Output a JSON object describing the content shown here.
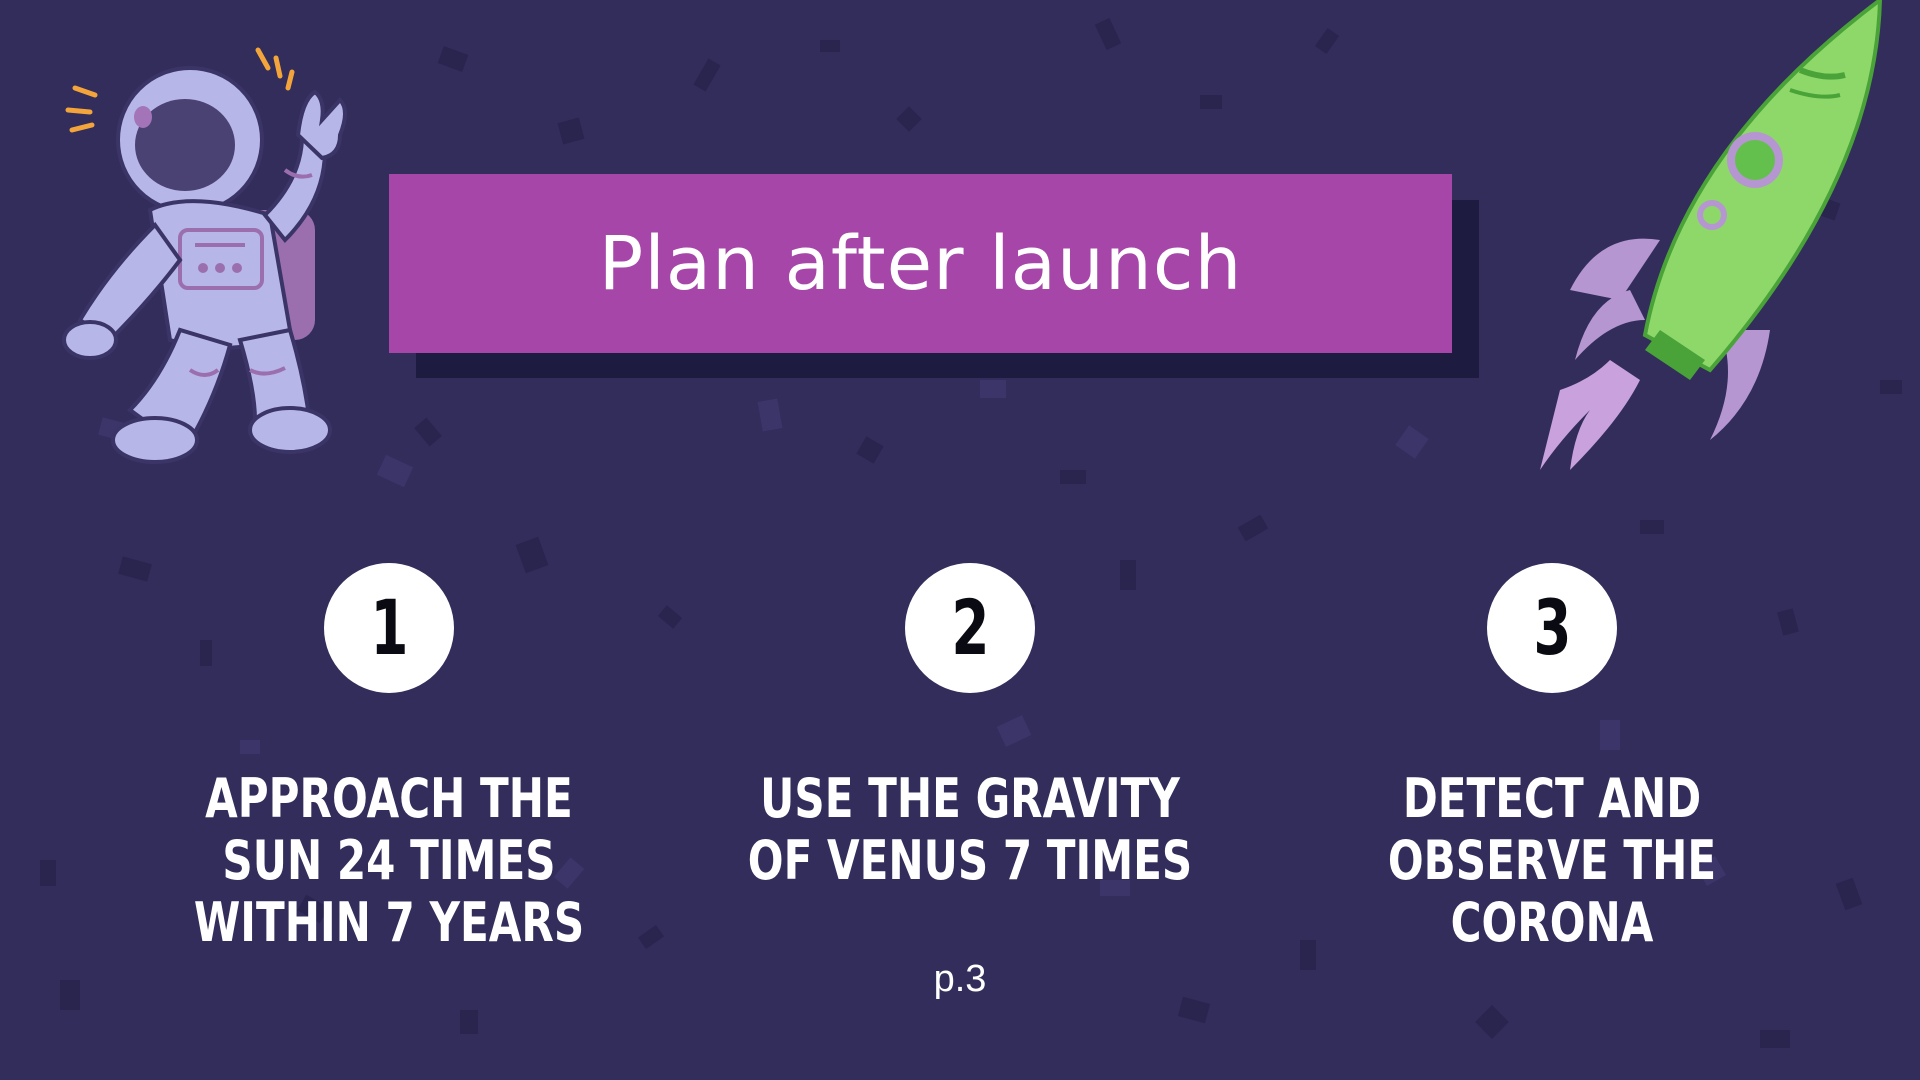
{
  "title": "Plan after launch",
  "steps": [
    {
      "number": "1",
      "text": "Approach the Sun  24 times within 7 years"
    },
    {
      "number": "2",
      "text": "Use the gravity of Venus 7 times"
    },
    {
      "number": "3",
      "text": "Detect and observe the corona"
    }
  ],
  "page_label": "p.3",
  "colors": {
    "background": "#322d5b",
    "title_box": "#a646a8",
    "title_shadow": "#1e1b40",
    "circle": "#ffffff",
    "text": "#ffffff"
  },
  "icons": [
    "astronaut-illustration",
    "rocket-illustration"
  ]
}
